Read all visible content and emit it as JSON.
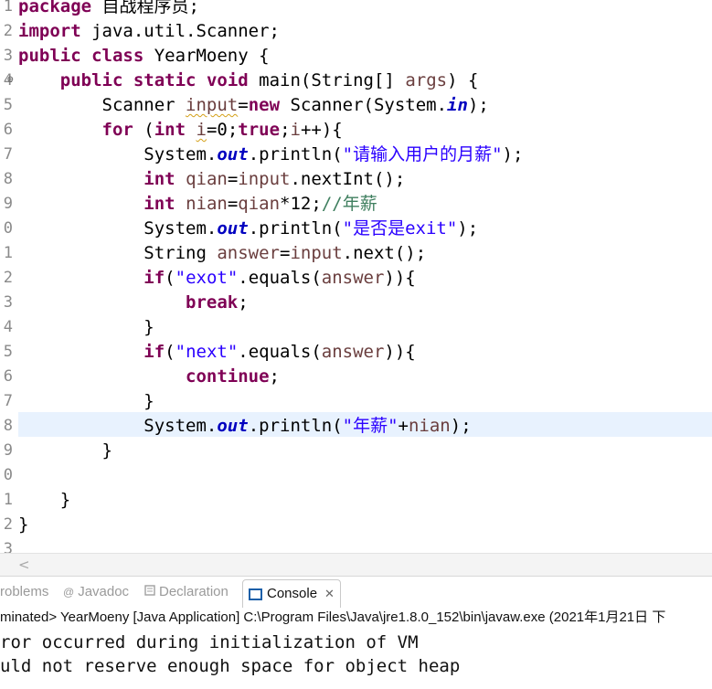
{
  "editor": {
    "line_numbers": [
      "1",
      "2",
      "3",
      "4",
      "5",
      "6",
      "7",
      "8",
      "9",
      "0",
      "1",
      "2",
      "3",
      "4",
      "5",
      "6",
      "7",
      "8",
      "9",
      "0",
      "1",
      "2",
      "3"
    ],
    "fold_marker": "⊖",
    "code": {
      "l1_kw": "package",
      "l1_rest": " 自战程序员;",
      "l2_kw": "import",
      "l2_rest": " java.util.Scanner;",
      "l3_kw1": "public",
      "l3_kw2": "class",
      "l3_rest": " YearMoeny {",
      "l4_kw1": "public",
      "l4_kw2": "static",
      "l4_kw3": "void",
      "l4_a": " main(String[] ",
      "l4_var": "args",
      "l4_b": ") {",
      "l5_a": "Scanner ",
      "l5_var": "input",
      "l5_b": "=",
      "l5_kw": "new",
      "l5_c": " Scanner(System.",
      "l5_fld": "in",
      "l5_d": ");",
      "l6_kw": "for",
      "l6_a": " (",
      "l6_kw2": "int",
      "l6_b": " ",
      "l6_var": "i",
      "l6_c": "=0;",
      "l6_kw3": "true",
      "l6_d": ";",
      "l6_var2": "i",
      "l6_e": "++){",
      "l7_a": "System.",
      "l7_fld": "out",
      "l7_b": ".println(",
      "l7_str": "\"请输入用户的月薪\"",
      "l7_c": ");",
      "l8_kw": "int",
      "l8_a": " ",
      "l8_var": "qian",
      "l8_b": "=",
      "l8_var2": "input",
      "l8_c": ".nextInt();",
      "l9_kw": "int",
      "l9_a": " ",
      "l9_var": "nian",
      "l9_b": "=",
      "l9_var2": "qian",
      "l9_c": "*12;",
      "l9_cmt": "//年薪",
      "l10_a": "System.",
      "l10_fld": "out",
      "l10_b": ".println(",
      "l10_str": "\"是否是exit\"",
      "l10_c": ");",
      "l11_a": "String ",
      "l11_var": "answer",
      "l11_b": "=",
      "l11_var2": "input",
      "l11_c": ".next();",
      "l12_kw": "if",
      "l12_a": "(",
      "l12_str": "\"exot\"",
      "l12_b": ".equals(",
      "l12_var": "answer",
      "l12_c": ")){",
      "l13_kw": "break",
      "l13_a": ";",
      "l14_a": "}",
      "l15_kw": "if",
      "l15_a": "(",
      "l15_str": "\"next\"",
      "l15_b": ".equals(",
      "l15_var": "answer",
      "l15_c": ")){",
      "l16_kw": "continue",
      "l16_a": ";",
      "l17_a": "}",
      "l18_a": "System.",
      "l18_fld": "out",
      "l18_b": ".println(",
      "l18_str": "\"年薪\"",
      "l18_c": "+",
      "l18_var": "nian",
      "l18_d": ");",
      "l19_a": "}",
      "l21_a": "}",
      "l22_a": "}"
    }
  },
  "scrollbar": {
    "left_arrow": "<"
  },
  "tabs": {
    "problems": "roblems",
    "javadoc_icon": "@",
    "javadoc": "Javadoc",
    "declaration": "Declaration",
    "console": "Console",
    "close": "✕"
  },
  "console": {
    "status": "minated> YearMoeny [Java Application] C:\\Program Files\\Java\\jre1.8.0_152\\bin\\javaw.exe (2021年1月21日 下",
    "output_line1": "ror occurred during initialization of VM",
    "output_line2": "uld not reserve enough space for object heap"
  },
  "colors": {
    "keyword": "#7f0055",
    "string": "#2a00ff",
    "field": "#0000c0",
    "variable": "#6a3e3e",
    "comment": "#3f7f5f",
    "highlight": "#e8f2fe"
  }
}
